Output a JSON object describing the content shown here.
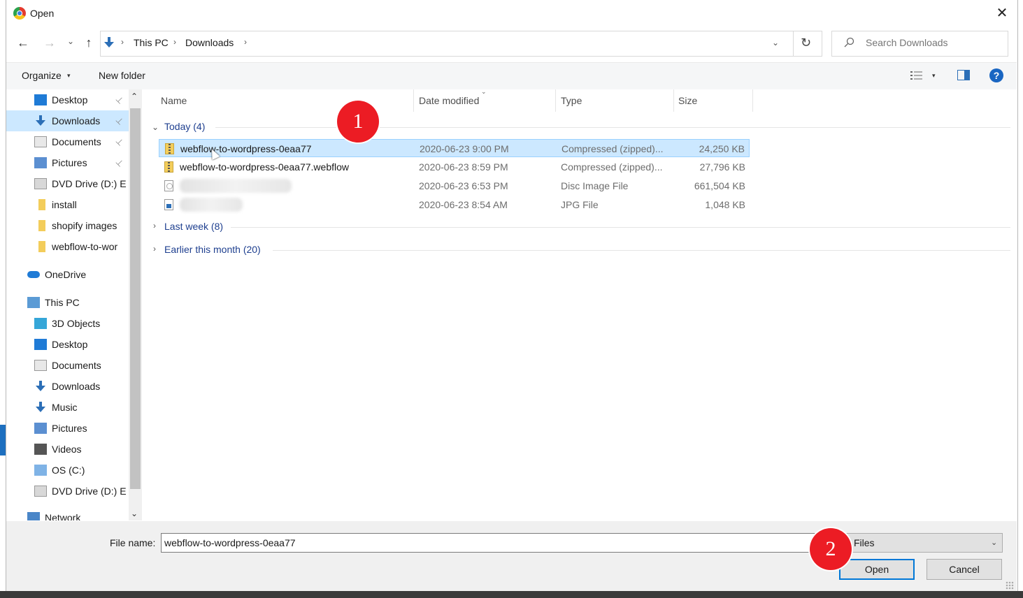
{
  "window": {
    "title": "Open",
    "close_label": "✕"
  },
  "nav": {
    "back": "←",
    "forward": "→",
    "recent": "⌄",
    "up": "↑",
    "refresh": "↻",
    "address_dropdown": "⌄",
    "breadcrumbs": [
      "This PC",
      "Downloads"
    ],
    "crumb_separator": "›"
  },
  "search": {
    "placeholder": "Search Downloads",
    "icon": "⌕"
  },
  "toolbar": {
    "organize_label": "Organize",
    "organize_caret": "▾",
    "new_folder_label": "New folder",
    "view_caret": "▾",
    "help_label": "?"
  },
  "nav_pane": {
    "items": [
      {
        "label": "Desktop",
        "icon": "desktop-icon",
        "pinned": true
      },
      {
        "label": "Downloads",
        "icon": "downloads-icon",
        "pinned": true,
        "selected": true
      },
      {
        "label": "Documents",
        "icon": "documents-icon",
        "pinned": true
      },
      {
        "label": "Pictures",
        "icon": "pictures-icon",
        "pinned": true
      },
      {
        "label": "DVD Drive (D:) E",
        "icon": "dvd-drive-icon"
      },
      {
        "label": "install",
        "icon": "folder-icon"
      },
      {
        "label": "shopify images",
        "icon": "folder-icon"
      },
      {
        "label": "webflow-to-wor",
        "icon": "folder-icon"
      },
      {
        "label": "OneDrive",
        "icon": "onedrive-icon"
      },
      {
        "label": "This PC",
        "icon": "this-pc-icon"
      },
      {
        "label": "3D Objects",
        "icon": "3d-objects-icon"
      },
      {
        "label": "Desktop",
        "icon": "desktop-icon"
      },
      {
        "label": "Documents",
        "icon": "documents-icon"
      },
      {
        "label": "Downloads",
        "icon": "downloads-icon"
      },
      {
        "label": "Music",
        "icon": "music-icon"
      },
      {
        "label": "Pictures",
        "icon": "pictures-icon"
      },
      {
        "label": "Videos",
        "icon": "videos-icon"
      },
      {
        "label": "OS (C:)",
        "icon": "os-drive-icon"
      },
      {
        "label": "DVD Drive (D:) E",
        "icon": "dvd-drive-icon"
      },
      {
        "label": "Network",
        "icon": "network-icon"
      }
    ],
    "pin_glyph": "📌",
    "scroll_up": "⌃",
    "scroll_down": "⌄"
  },
  "file_list": {
    "columns": [
      "Name",
      "Date modified",
      "Type",
      "Size"
    ],
    "sort_caret": "⌄",
    "groups": [
      {
        "label": "Today (4)",
        "expanded": true,
        "chevron": "⌄"
      },
      {
        "label": "Last week (8)",
        "expanded": false,
        "chevron": "›"
      },
      {
        "label": "Earlier this month (20)",
        "expanded": false,
        "chevron": "›"
      }
    ],
    "files": [
      {
        "name": "webflow-to-wordpress-0eaa77",
        "date": "2020-06-23 9:00 PM",
        "type": "Compressed (zipped)...",
        "size": "24,250 KB",
        "icon": "zip-icon",
        "selected": true
      },
      {
        "name": "webflow-to-wordpress-0eaa77.webflow",
        "date": "2020-06-23 8:59 PM",
        "type": "Compressed (zipped)...",
        "size": "27,796 KB",
        "icon": "zip-icon"
      },
      {
        "name": "",
        "date": "2020-06-23 6:53 PM",
        "type": "Disc Image File",
        "size": "661,504 KB",
        "icon": "disc-image-icon",
        "blurred": true
      },
      {
        "name": "",
        "date": "2020-06-23 8:54 AM",
        "type": "JPG File",
        "size": "1,048 KB",
        "icon": "jpg-icon",
        "blurred": true
      }
    ]
  },
  "footer": {
    "filename_label": "File name:",
    "filename_value": "webflow-to-wordpress-0eaa77",
    "filetype_value": "l Files",
    "filetype_caret": "⌄",
    "open_label": "Open",
    "cancel_label": "Cancel"
  },
  "markers": [
    "1",
    "2"
  ]
}
